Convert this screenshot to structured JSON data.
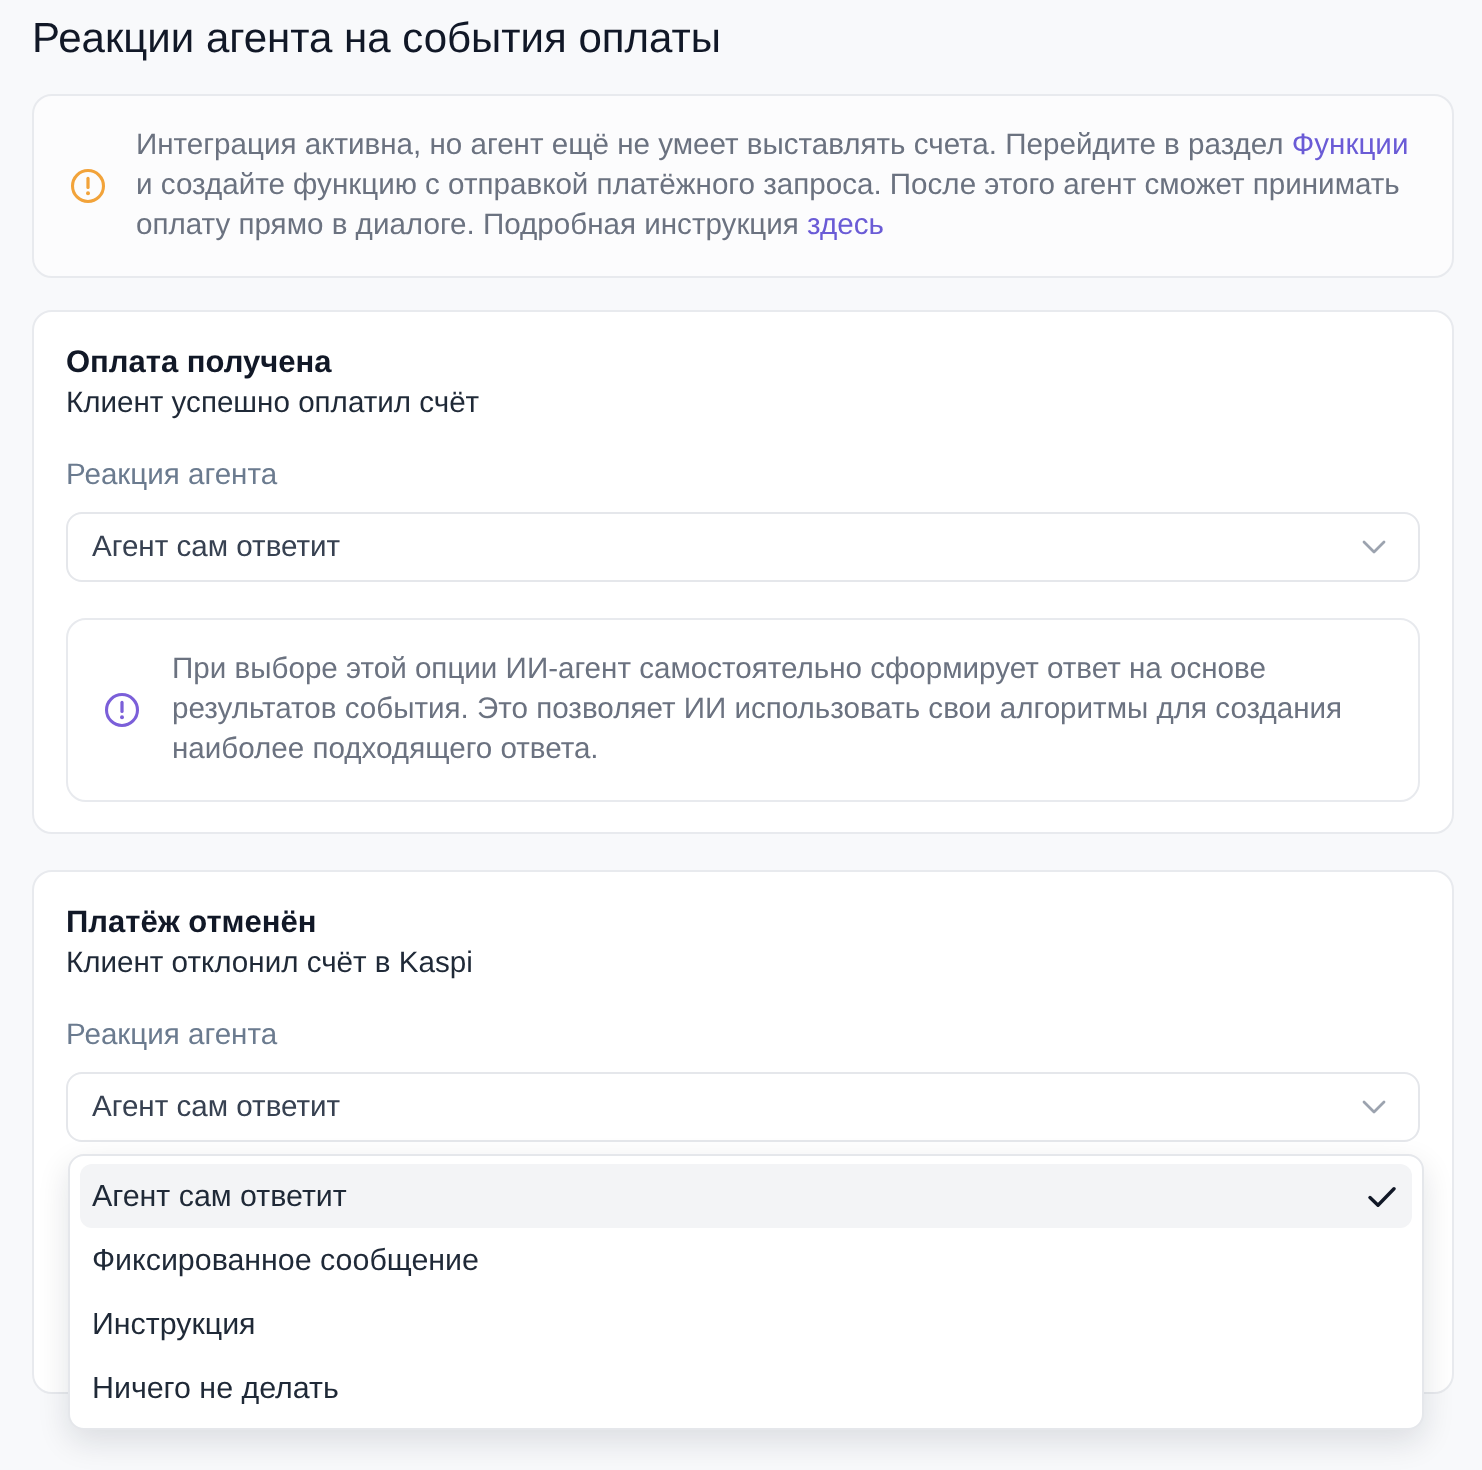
{
  "page": {
    "title": "Реакции агента на события оплаты"
  },
  "notice": {
    "segments": [
      {
        "kind": "text",
        "text": "Интеграция активна, но агент ещё не умеет выставлять счета. Перейдите в раздел "
      },
      {
        "kind": "link",
        "text": "Функции"
      },
      {
        "kind": "text",
        "text": " и создайте функцию с отправкой платёжного запроса. После этого агент сможет принимать оплату прямо в диалоге. Подробная инструкция "
      },
      {
        "kind": "link",
        "text": "здесь"
      }
    ]
  },
  "events": [
    {
      "title": "Оплата получена",
      "subtitle": "Клиент успешно оплатил счёт",
      "field_label": "Реакция агента",
      "select": {
        "value": "Агент сам ответит"
      },
      "hint": "При выборе этой опции ИИ-агент самостоятельно сформирует ответ на основе результатов события. Это позволяет ИИ использовать свои алгоритмы для создания наиболее подходящего ответа."
    },
    {
      "title": "Платёж отменён",
      "subtitle": "Клиент отклонил счёт в Kaspi",
      "field_label": "Реакция агента",
      "select": {
        "value": "Агент сам ответит",
        "options": [
          {
            "label": "Агент сам ответит",
            "selected": true
          },
          {
            "label": "Фиксированное сообщение",
            "selected": false
          },
          {
            "label": "Инструкция",
            "selected": false
          },
          {
            "label": "Ничего не делать",
            "selected": false
          }
        ]
      }
    }
  ]
}
